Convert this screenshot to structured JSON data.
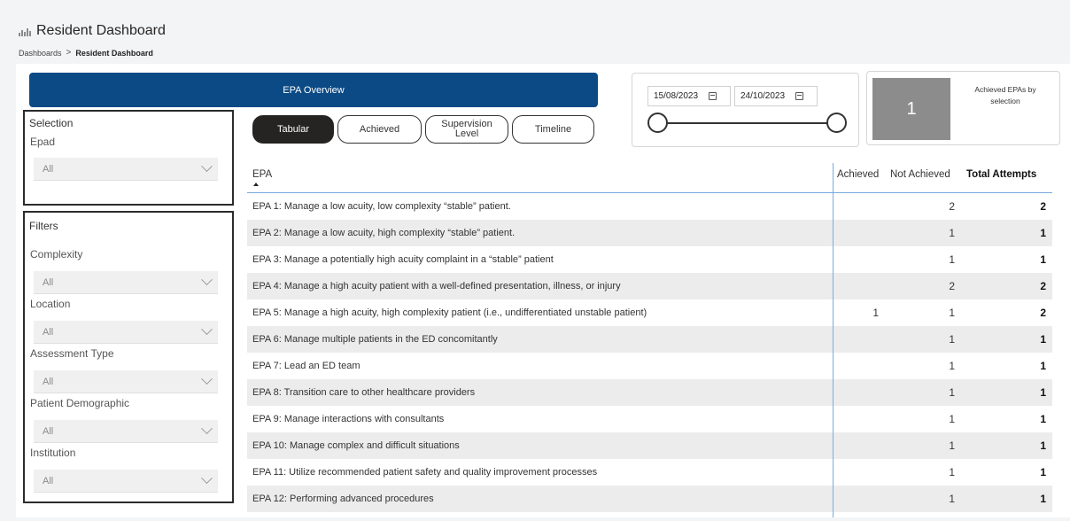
{
  "header": {
    "title": "Resident Dashboard",
    "icon": "bar-chart-icon",
    "breadcrumb": {
      "parent": "Dashboards",
      "separator": ">",
      "current": "Resident Dashboard"
    }
  },
  "overview_bar": {
    "label": "EPA Overview",
    "color": "#0b4a85"
  },
  "selection": {
    "title": "Selection",
    "epad_label": "Epad",
    "epad_value": "All"
  },
  "filters": {
    "title": "Filters",
    "items": [
      {
        "label": "Complexity",
        "value": "All"
      },
      {
        "label": "Location",
        "value": "All"
      },
      {
        "label": "Assessment Type",
        "value": "All"
      },
      {
        "label": "Patient Demographic",
        "value": "All"
      },
      {
        "label": "Institution",
        "value": "All"
      }
    ]
  },
  "tabs": [
    {
      "label": "Tabular",
      "active": true
    },
    {
      "label": "Achieved",
      "active": false
    },
    {
      "label": "Supervision Level",
      "active": false
    },
    {
      "label": "Timeline",
      "active": false
    }
  ],
  "date_range": {
    "start": "15/08/2023",
    "end": "24/10/2023"
  },
  "kpi": {
    "value": "1",
    "label": "Achieved EPAs by selection"
  },
  "table": {
    "columns": [
      "EPA",
      "Achieved",
      "Not Achieved",
      "Total Attempts"
    ],
    "sort": "ascending",
    "rows": [
      {
        "epa": "EPA 1: Manage a low acuity, low complexity “stable” patient.",
        "achieved": "",
        "not_achieved": "2",
        "total": "2"
      },
      {
        "epa": "EPA 2: Manage a low acuity, high complexity “stable” patient.",
        "achieved": "",
        "not_achieved": "1",
        "total": "1"
      },
      {
        "epa": "EPA 3: Manage a potentially high acuity complaint in a “stable” patient",
        "achieved": "",
        "not_achieved": "1",
        "total": "1"
      },
      {
        "epa": "EPA 4: Manage a high acuity patient with a well-defined presentation, illness, or injury",
        "achieved": "",
        "not_achieved": "2",
        "total": "2"
      },
      {
        "epa": "EPA 5: Manage a high acuity, high complexity patient (i.e., undifferentiated unstable patient)",
        "achieved": "1",
        "not_achieved": "1",
        "total": "2"
      },
      {
        "epa": "EPA 6: Manage multiple patients in the ED concomitantly",
        "achieved": "",
        "not_achieved": "1",
        "total": "1"
      },
      {
        "epa": "EPA 7: Lead an ED team",
        "achieved": "",
        "not_achieved": "1",
        "total": "1"
      },
      {
        "epa": "EPA 8: Transition care to other healthcare providers",
        "achieved": "",
        "not_achieved": "1",
        "total": "1"
      },
      {
        "epa": "EPA 9: Manage interactions with consultants",
        "achieved": "",
        "not_achieved": "1",
        "total": "1"
      },
      {
        "epa": "EPA 10: Manage complex and difficult situations",
        "achieved": "",
        "not_achieved": "1",
        "total": "1"
      },
      {
        "epa": "EPA 11: Utilize recommended patient safety and quality improvement processes",
        "achieved": "",
        "not_achieved": "1",
        "total": "1"
      },
      {
        "epa": "EPA 12: Performing advanced procedures",
        "achieved": "",
        "not_achieved": "1",
        "total": "1"
      }
    ]
  }
}
